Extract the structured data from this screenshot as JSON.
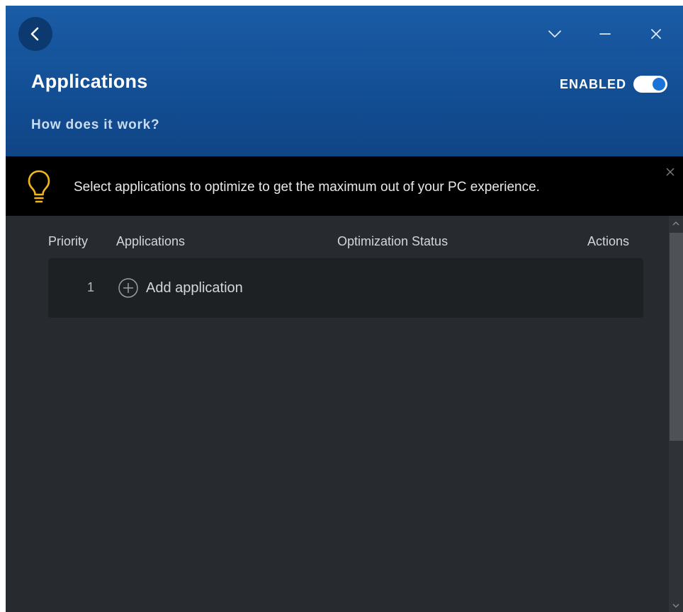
{
  "header": {
    "title": "Applications",
    "toggle_label": "ENABLED",
    "toggle_on": true,
    "help_link": "How does it work?"
  },
  "banner": {
    "text": "Select applications to optimize to get the maximum out of your PC experience."
  },
  "table": {
    "columns": [
      "Priority",
      "Applications",
      "Optimization Status",
      "Actions"
    ],
    "rows": [
      {
        "priority": "1",
        "action_label": "Add application"
      }
    ]
  },
  "colors": {
    "header_blue": "#134f95",
    "toggle_accent": "#1a73d6",
    "tip_icon": "#f2b51a",
    "background": "#272a2e"
  },
  "icons": {
    "back": "chevron-left-icon",
    "collapse": "chevron-down-icon",
    "minimize": "minimize-icon",
    "close": "close-icon",
    "tip": "lightbulb-icon",
    "add": "plus-circle-icon"
  }
}
